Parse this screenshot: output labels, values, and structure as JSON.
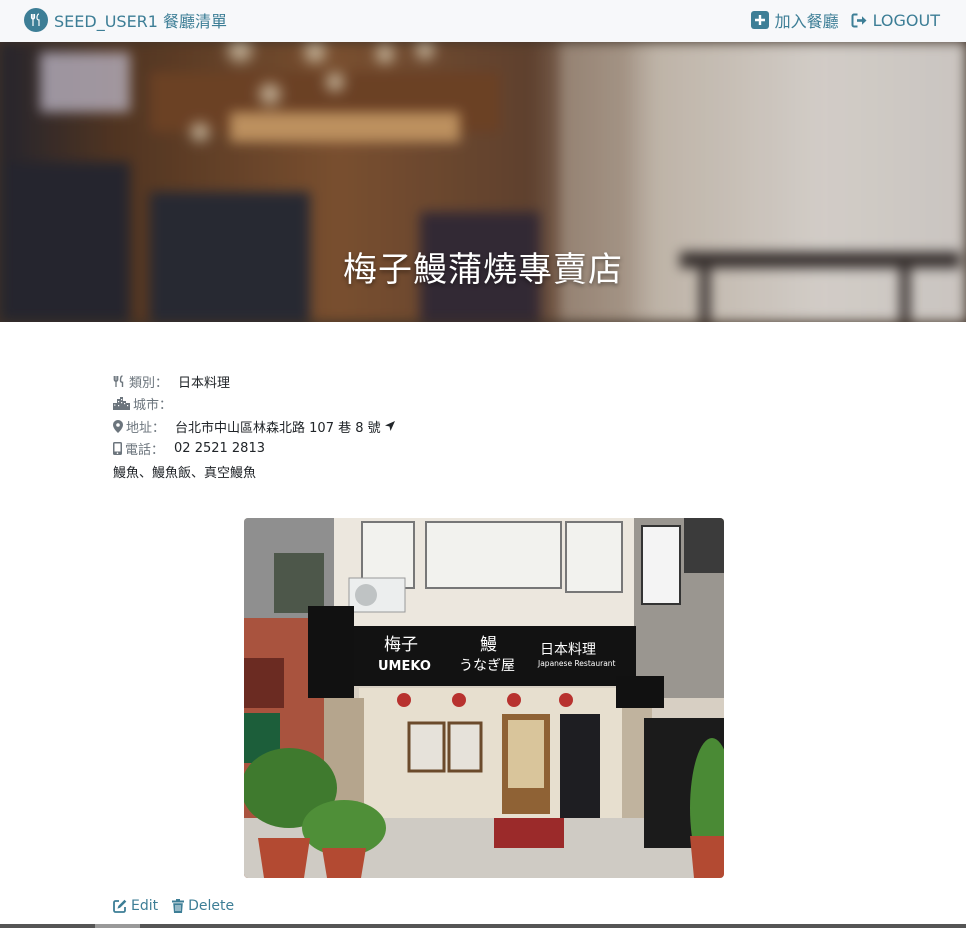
{
  "navbar": {
    "brand": "SEED_USER1 餐廳清單",
    "add_restaurant": "加入餐廳",
    "logout": "LOGOUT"
  },
  "restaurant": {
    "name": "梅子鰻蒲燒專賣店",
    "category_label": "類別：",
    "category": "日本料理",
    "city_label": "城市：",
    "city": "",
    "address_label": "地址：",
    "address": "台北市中山區林森北路 107 巷 8 號",
    "phone_label": "電話：",
    "phone": "02 2521 2813",
    "description": "鰻魚、鰻魚飯、真空鰻魚"
  },
  "sign": {
    "brand_jp": "梅子",
    "brand_en": "UMEKO",
    "eel_kanji": "鰻",
    "eel_kana": "うなぎ屋",
    "cuisine_jp": "日本料理",
    "cuisine_en": "Japanese Restaurant"
  },
  "actions": {
    "edit": "Edit",
    "delete": "Delete"
  },
  "colors": {
    "accent": "#3d7e96",
    "navbar_bg": "#f7f8fa",
    "label": "#6c757d"
  }
}
